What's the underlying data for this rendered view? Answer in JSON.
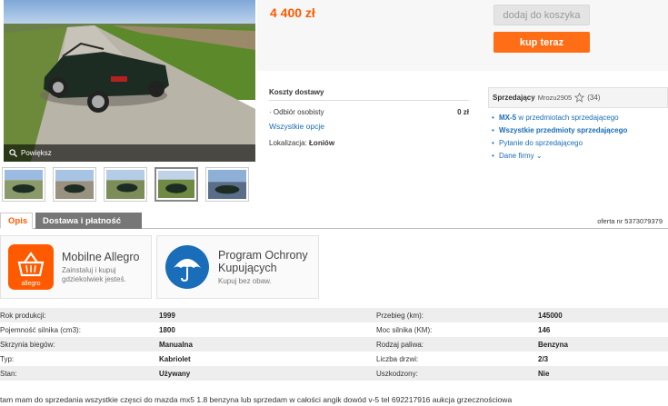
{
  "gallery": {
    "zoom_label": "Powiększ",
    "thumbnails": [
      "car-photo-1",
      "car-photo-2",
      "car-photo-3",
      "car-photo-4",
      "car-photo-5"
    ],
    "active_thumbnail": 4
  },
  "offer": {
    "price": "4 400 zł",
    "add_to_cart_label": "dodaj do koszyka",
    "buy_now_label": "kup teraz",
    "accent_color": "#ff5a00",
    "buy_button_color": "#ff6d16"
  },
  "delivery": {
    "title": "Koszty dostawy",
    "pickup_label": "Odbiór osobisty",
    "pickup_cost": "0 zł",
    "all_options_link": "Wszystkie opcje",
    "location_label": "Lokalizacja:",
    "location_value": "Łoniów"
  },
  "seller": {
    "label": "Sprzedający",
    "name": "Mrozu2905",
    "rating_count": "(34)",
    "links": {
      "item_model": "MX-5",
      "item_suffix": " w przedmiotach sprzedającego",
      "all_items": "Wszystkie przedmioty sprzedającego",
      "ask": "Pytanie do sprzedającego",
      "company": "Dane firmy"
    }
  },
  "tabs": {
    "description": "Opis",
    "delivery": "Dostawa i płatność",
    "offer_number": "oferta nr 5373079379"
  },
  "promos": [
    {
      "title": "Mobilne Allegro",
      "subtitle_1": "Zainstaluj i kupuj",
      "subtitle_2": "gdziekolwiek jesteś.",
      "logo_text": "allegro",
      "icon": "basket-icon",
      "color": "#ff5a00"
    },
    {
      "title": "Program Ochrony",
      "title_2": "Kupujących",
      "subtitle_1": "Kupuj bez obaw.",
      "icon": "umbrella-icon",
      "color": "#1a6db8"
    }
  ],
  "specs": [
    {
      "l1": "Rok produkcji:",
      "v1": "1999",
      "l2": "Przebieg (km):",
      "v2": "145000"
    },
    {
      "l1": "Pojemność silnika (cm3):",
      "v1": "1800",
      "l2": "Moc silnika (KM):",
      "v2": "146"
    },
    {
      "l1": "Skrzynia biegów:",
      "v1": "Manualna",
      "l2": "Rodzaj paliwa:",
      "v2": "Benzyna"
    },
    {
      "l1": "Typ:",
      "v1": "Kabriolet",
      "l2": "Liczba drzwi:",
      "v2": "2/3"
    },
    {
      "l1": "Stan:",
      "v1": "Używany",
      "l2": "Uszkodzony:",
      "v2": "Nie"
    }
  ],
  "description": "tam mam do sprzedania wszystkie częsci do mazda mx5 1.8 benzyna lub sprzedam w całości angik dowód v-5 tel 692217916 aukcja grzecznościowa"
}
